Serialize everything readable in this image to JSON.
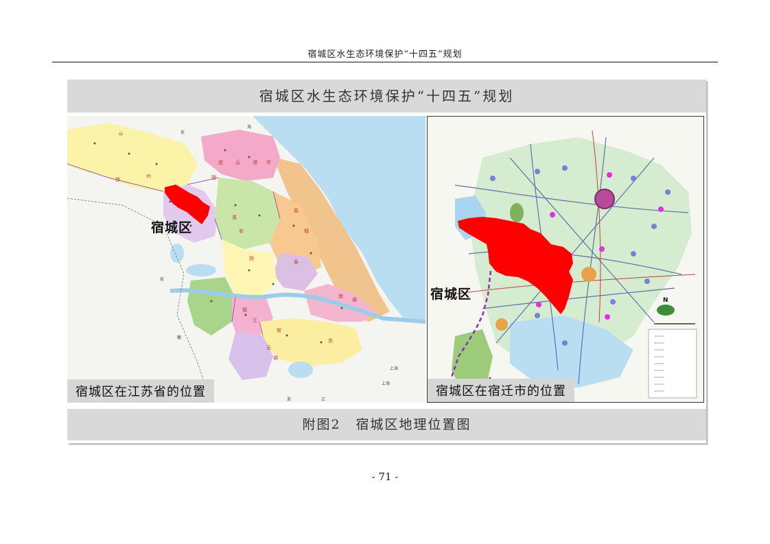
{
  "document": {
    "running_header": "宿城区水生态环境保护“十四五”规划",
    "page_number": "- 71 -"
  },
  "figure": {
    "title": "宿城区水生态环境保护“十四五”规划",
    "caption_number": "附图2",
    "caption_text": "宿城区地理位置图",
    "left_map": {
      "highlight_label": "宿城区",
      "caption": "宿城区在江苏省的位置",
      "place_labels": [
        "山",
        "东",
        "海",
        "宿",
        "徐",
        "州",
        "连",
        "云",
        "港",
        "市",
        "淮",
        "安",
        "盐",
        "城",
        "扬",
        "泰",
        "南",
        "通",
        "镇",
        "江",
        "常",
        "无",
        "锡",
        "苏",
        "上海",
        "浙",
        "江",
        "徽",
        "安",
        "上海"
      ]
    },
    "right_map": {
      "highlight_label": "宿城区",
      "caption": "宿城区在宿迁市的位置",
      "compass": "N"
    }
  },
  "colors": {
    "highlight_red": "#ff0000",
    "sea_blue": "#b9def2",
    "caption_gray": "#d9d9d9",
    "boundary_purple": "#8e2fb0"
  }
}
